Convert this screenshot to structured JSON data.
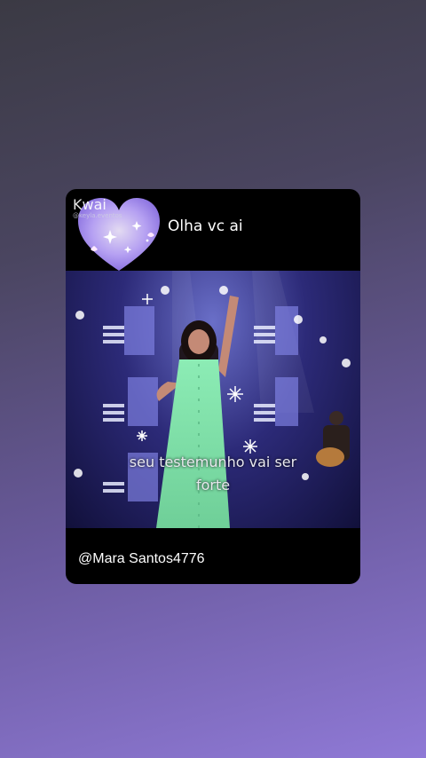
{
  "story": {
    "kwai_brand": "Kwai",
    "kwai_handle": "@keyla.eventos",
    "header_caption": "Olha vc ai",
    "subtitle_line1": "seu testemunho vai ser",
    "subtitle_line2": "forte",
    "username": "@Mara Santos4776"
  },
  "colors": {
    "accent_heart": "#b9a6ff",
    "dress": "#7fe0a8",
    "stage_blue": "#2c2a78"
  },
  "icons": [
    "heart-sticker-icon",
    "kwai-logo-icon",
    "snowflake-icon"
  ]
}
